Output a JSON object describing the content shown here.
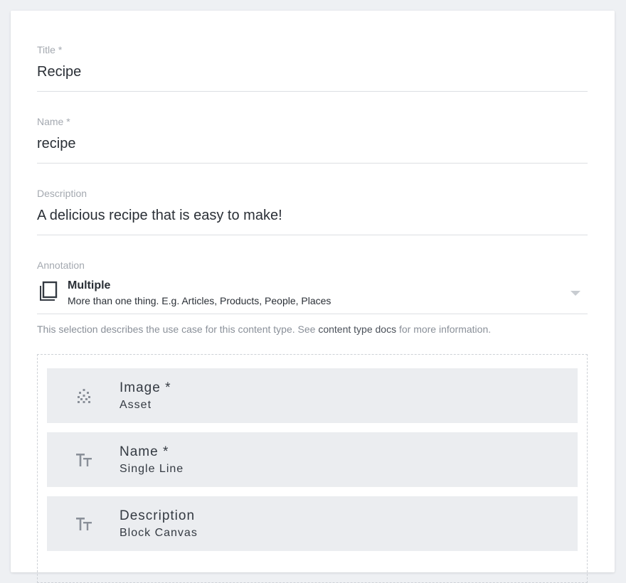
{
  "form": {
    "title": {
      "label": "Title *",
      "value": "Recipe"
    },
    "name": {
      "label": "Name *",
      "value": "recipe"
    },
    "description": {
      "label": "Description",
      "value": "A delicious recipe that is easy to make!"
    },
    "annotation": {
      "label": "Annotation",
      "selected_title": "Multiple",
      "selected_subtitle": "More than one thing. E.g. Articles, Products, People, Places",
      "icon": "copy-icon"
    },
    "helper": {
      "prefix": "This selection describes the use case for this content type. See ",
      "link": "content type docs",
      "suffix": " for more information."
    }
  },
  "blocks": [
    {
      "title": "Image *",
      "subtitle": "Asset",
      "icon": "asset-icon"
    },
    {
      "title": "Name *",
      "subtitle": "Single Line",
      "icon": "text-icon"
    },
    {
      "title": "Description",
      "subtitle": "Block Canvas",
      "icon": "text-icon"
    }
  ],
  "colors": {
    "page_bg": "#eef0f3",
    "card_bg": "#ffffff",
    "block_bg": "#ebedf0",
    "text": "#2a2f36",
    "label": "#a4a9b0"
  }
}
